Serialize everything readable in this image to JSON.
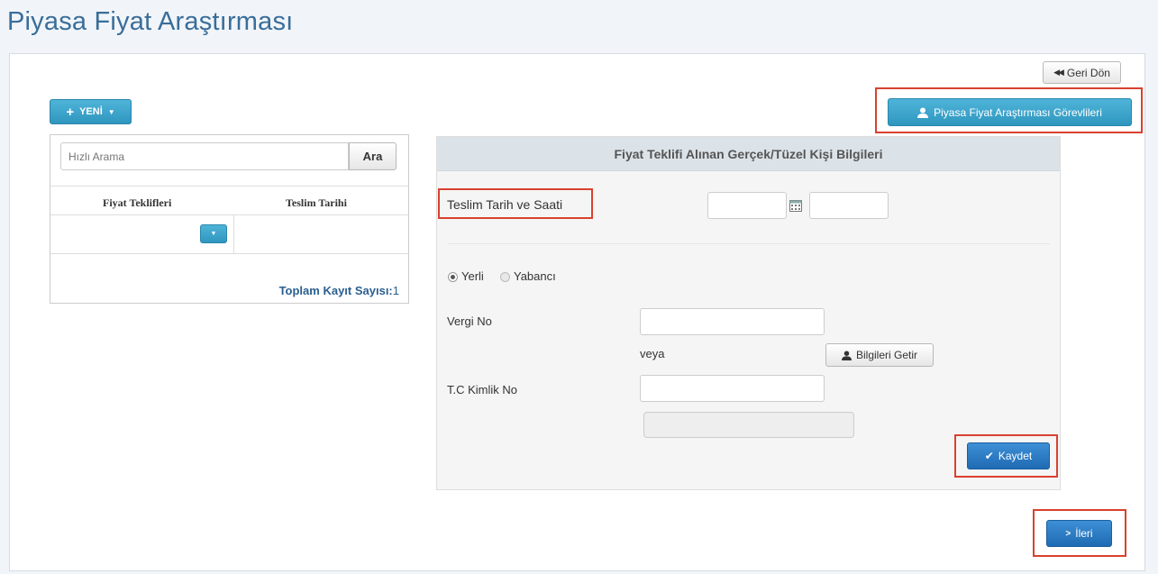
{
  "page": {
    "title": "Piyasa Fiyat Araştırması"
  },
  "toolbar": {
    "back_label": "Geri Dön",
    "new_label": "YENİ",
    "staff_label": "Piyasa Fiyat Araştırması Görevlileri"
  },
  "left_panel": {
    "search_placeholder": "Hızlı Arama",
    "search_button": "Ara",
    "columns": [
      "Fiyat Teklifleri",
      "Teslim Tarihi"
    ],
    "total_label": "Toplam Kayıt Sayısı:",
    "total_value": "1"
  },
  "form": {
    "header": "Fiyat Teklifi Alınan Gerçek/Tüzel Kişi Bilgileri",
    "delivery_label": "Teslim Tarih ve Saati",
    "radio_local": "Yerli",
    "radio_foreign": "Yabancı",
    "tax_no_label": "Vergi No",
    "or_label": "veya",
    "fetch_button": "Bilgileri Getir",
    "tc_no_label": "T.C Kimlik No",
    "save_button": "Kaydet"
  },
  "footer": {
    "next_button": "İleri"
  },
  "colors": {
    "title": "#3a6d99",
    "cyan_button": "#2f96bf",
    "blue_button": "#1f6bb3",
    "highlight": "#d9412f"
  },
  "icons": [
    "rewind-icon",
    "plus-icon",
    "caret-down-icon",
    "user-icon",
    "calendar-icon",
    "check-icon",
    "chevron-right-icon"
  ]
}
